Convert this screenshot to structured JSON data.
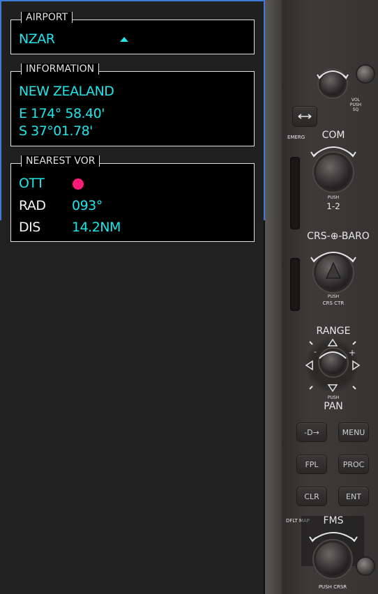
{
  "airport_panel": {
    "title": "AIRPORT",
    "identifier": "NZAR"
  },
  "information_panel": {
    "title": "INFORMATION",
    "country": "NEW ZEALAND",
    "longitude": "E 174° 58.40'",
    "latitude": "S 37°01.78'"
  },
  "nearest_vor_panel": {
    "title": "NEAREST VOR",
    "ident": "OTT",
    "rad_label": "RAD",
    "rad_value": "093°",
    "dis_label": "DIS",
    "dis_value": "14.2NM"
  },
  "bezel": {
    "vol_label": "VOL PUSH SQ",
    "emerg_label": "EMERG",
    "com_label": "COM",
    "com_push": "PUSH",
    "com_sub": "1-2",
    "crs_baro_label": "CRS-⊕-BARO",
    "crs_push": "PUSH",
    "crs_sub": "CRS CTR",
    "range_label": "RANGE",
    "range_push": "PUSH",
    "range_sub": "PAN",
    "buttons": {
      "direct": "-D→",
      "menu": "MENU",
      "fpl": "FPL",
      "proc": "PROC",
      "clr": "CLR",
      "ent": "ENT"
    },
    "dflt_map": "DFLT MAP",
    "fms_label": "FMS",
    "fms_push": "PUSH CRSR"
  },
  "colors": {
    "cyan": "#1fe6ea",
    "magenta": "#ff1a7a",
    "border_blue": "#3d7bd9"
  }
}
